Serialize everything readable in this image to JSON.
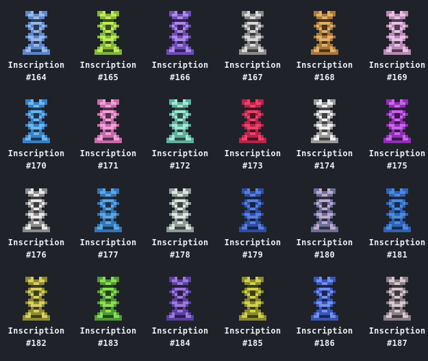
{
  "items": [
    {
      "label": "Inscription",
      "number": "#164",
      "color": "#5b86c9",
      "accent": "#9bb7e6",
      "icon": "totem-icon"
    },
    {
      "label": "Inscription",
      "number": "#165",
      "color": "#7fb53b",
      "accent": "#c5e85b",
      "icon": "totem-icon"
    },
    {
      "label": "Inscription",
      "number": "#166",
      "color": "#6f4bb8",
      "accent": "#a98ae6",
      "icon": "totem-icon"
    },
    {
      "label": "Inscription",
      "number": "#167",
      "color": "#8a8a8a",
      "accent": "#d9d9d9",
      "icon": "totem-icon"
    },
    {
      "label": "Inscription",
      "number": "#168",
      "color": "#a8773a",
      "accent": "#e0b068",
      "icon": "totem-icon"
    },
    {
      "label": "Inscription",
      "number": "#169",
      "color": "#b98ab5",
      "accent": "#e7c2e3",
      "icon": "totem-icon"
    },
    {
      "label": "Inscription",
      "number": "#170",
      "color": "#3a7fc2",
      "accent": "#6db6ec",
      "icon": "totem-icon"
    },
    {
      "label": "Inscription",
      "number": "#171",
      "color": "#c46aa9",
      "accent": "#f0a1d6",
      "icon": "totem-icon"
    },
    {
      "label": "Inscription",
      "number": "#172",
      "color": "#5fae9c",
      "accent": "#a6e6d2",
      "icon": "totem-icon"
    },
    {
      "label": "Inscription",
      "number": "#173",
      "color": "#b8234a",
      "accent": "#e8436c",
      "icon": "totem-icon"
    },
    {
      "label": "Inscription",
      "number": "#174",
      "color": "#9a9a9a",
      "accent": "#efefef",
      "icon": "totem-icon"
    },
    {
      "label": "Inscription",
      "number": "#175",
      "color": "#8f2fb3",
      "accent": "#c766e6",
      "icon": "totem-icon"
    },
    {
      "label": "Inscription",
      "number": "#176",
      "color": "#8c8c8c",
      "accent": "#e8e8e8",
      "icon": "totem-icon"
    },
    {
      "label": "Inscription",
      "number": "#177",
      "color": "#3275b8",
      "accent": "#5fa6e0",
      "icon": "totem-icon"
    },
    {
      "label": "Inscription",
      "number": "#178",
      "color": "#8d9a95",
      "accent": "#dde5e0",
      "icon": "totem-icon"
    },
    {
      "label": "Inscription",
      "number": "#179",
      "color": "#2c4ea8",
      "accent": "#5b7fd6",
      "icon": "totem-icon"
    },
    {
      "label": "Inscription",
      "number": "#180",
      "color": "#6b6f9a",
      "accent": "#c2a9c9",
      "icon": "totem-icon"
    },
    {
      "label": "Inscription",
      "number": "#181",
      "color": "#2d63b8",
      "accent": "#4f8ad8",
      "icon": "totem-icon"
    },
    {
      "label": "Inscription",
      "number": "#182",
      "color": "#8d8a2f",
      "accent": "#d6d066",
      "icon": "totem-icon"
    },
    {
      "label": "Inscription",
      "number": "#183",
      "color": "#4f9a34",
      "accent": "#8fdc5a",
      "icon": "totem-icon"
    },
    {
      "label": "Inscription",
      "number": "#184",
      "color": "#5c3fa3",
      "accent": "#9a7ad6",
      "icon": "totem-icon"
    },
    {
      "label": "Inscription",
      "number": "#185",
      "color": "#8a8a2a",
      "accent": "#cfd04f",
      "icon": "totem-icon"
    },
    {
      "label": "Inscription",
      "number": "#186",
      "color": "#3a55b8",
      "accent": "#7390ec",
      "icon": "totem-icon"
    },
    {
      "label": "Inscription",
      "number": "#187",
      "color": "#8a7f84",
      "accent": "#d7c7cf",
      "icon": "totem-icon"
    }
  ]
}
